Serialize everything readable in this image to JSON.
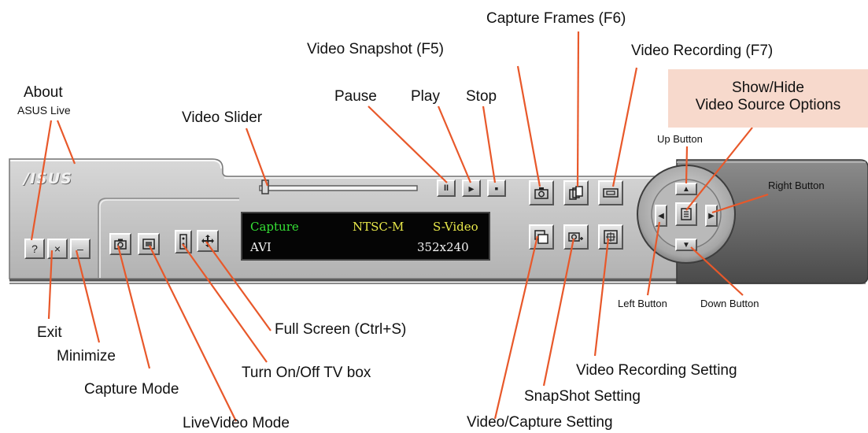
{
  "labels": {
    "about": "About",
    "asus_live": "ASUS Live",
    "video_slider": "Video Slider",
    "pause": "Pause",
    "play": "Play",
    "stop": "Stop",
    "video_snapshot": "Video Snapshot (F5)",
    "capture_frames": "Capture Frames (F6)",
    "video_recording": "Video Recording (F7)",
    "show_hide_line1": "Show/Hide",
    "show_hide_line2": "Video Source Options",
    "up_button": "Up Button",
    "right_button": "Right Button",
    "left_button": "Left Button",
    "down_button": "Down Button",
    "exit": "Exit",
    "minimize": "Minimize",
    "capture_mode": "Capture Mode",
    "livevideo_mode": "LiveVideo Mode",
    "full_screen": "Full Screen (Ctrl+S)",
    "turn_onoff_tv": "Turn On/Off TV box",
    "video_recording_setting": "Video Recording Setting",
    "snapshot_setting": "SnapShot Setting",
    "video_capture_setting": "Video/Capture Setting"
  },
  "panel": {
    "logo": "/ISUS",
    "lcd": {
      "mode": "Capture",
      "standard": "NTSC-M",
      "input": "S-Video",
      "format": "AVI",
      "resolution": "352x240"
    },
    "buttons": {
      "about": "?",
      "exit": "×",
      "minimize": "–",
      "pause": "II",
      "play": "▸",
      "stop": "▪"
    }
  },
  "colors": {
    "highlight": "#f7d9cc",
    "callout_line": "#e8582a",
    "lcd_background": "#050505",
    "lcd_mode_text": "#35e035",
    "lcd_value_text": "#e8e84a",
    "lcd_info_text": "#f2f2f2",
    "panel_face": "#c8c8c8"
  }
}
